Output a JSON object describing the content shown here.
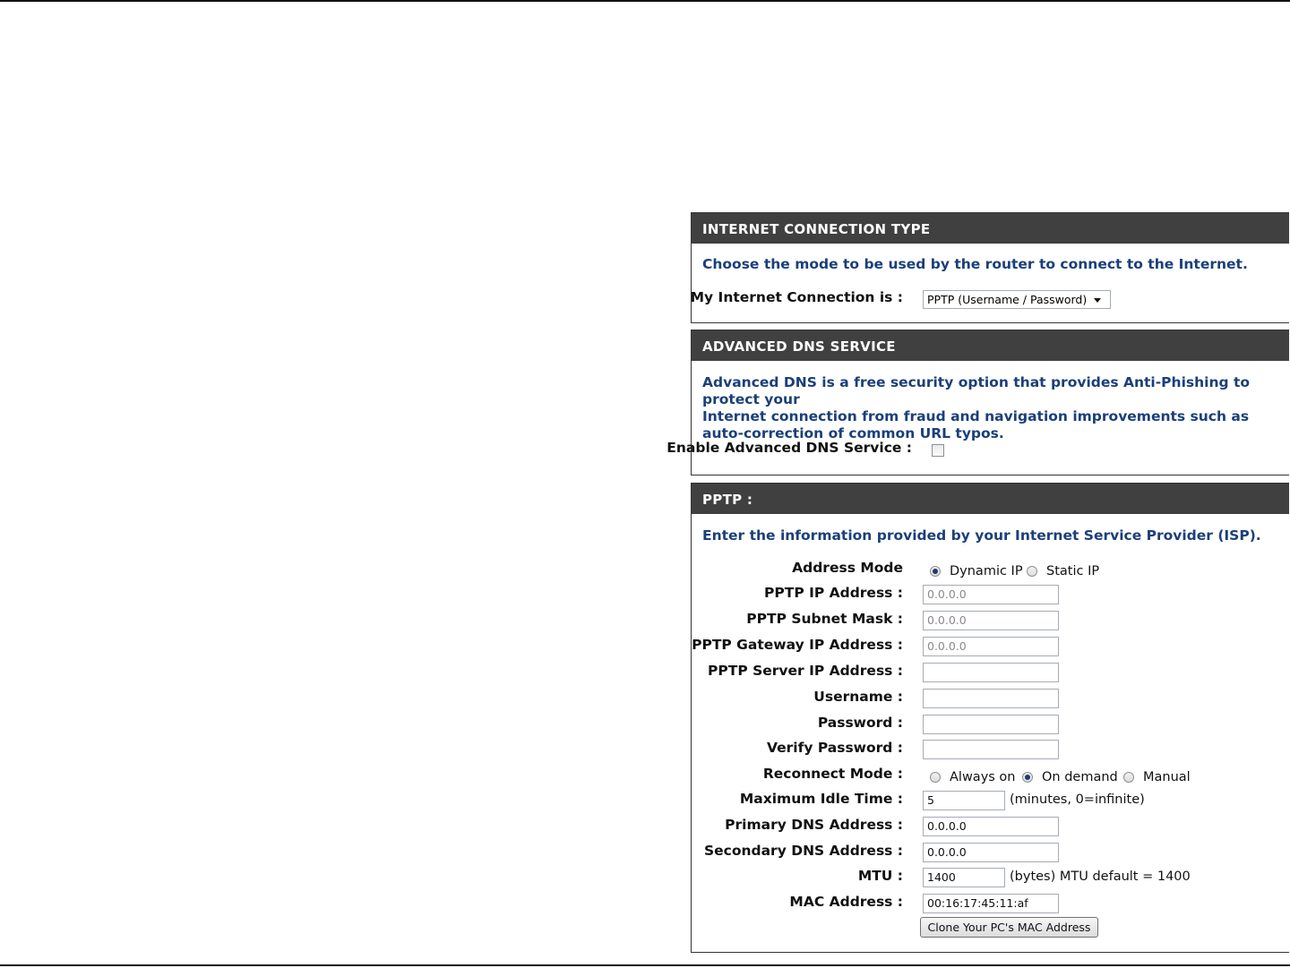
{
  "sections": {
    "connection_type": {
      "header": "INTERNET CONNECTION TYPE",
      "intro": "Choose the mode to be used by the router to connect to the Internet.",
      "label": "My Internet Connection is :",
      "selected": "PPTP (Username / Password)"
    },
    "advanced_dns": {
      "header": "ADVANCED DNS SERVICE",
      "intro_lines": [
        "Advanced DNS is a free security option that provides Anti-Phishing to protect your",
        "Internet connection from fraud and navigation improvements such as",
        "auto-correction of common URL typos."
      ],
      "label": "Enable Advanced DNS Service :",
      "enabled": false
    },
    "pptp": {
      "header": "PPTP :",
      "intro": "Enter the information provided by your Internet Service Provider (ISP).",
      "address_mode": {
        "label": "Address Mode",
        "options": [
          "Dynamic IP",
          "Static IP"
        ],
        "selected": "Dynamic IP"
      },
      "ip_address": {
        "label": "PPTP IP Address :",
        "value": "0.0.0.0"
      },
      "subnet_mask": {
        "label": "PPTP Subnet Mask :",
        "value": "0.0.0.0"
      },
      "gateway": {
        "label": "PPTP Gateway IP Address :",
        "value": "0.0.0.0"
      },
      "server_ip": {
        "label": "PPTP Server IP Address :",
        "value": ""
      },
      "username": {
        "label": "Username :",
        "value": ""
      },
      "password": {
        "label": "Password :",
        "value": ""
      },
      "verify_password": {
        "label": "Verify Password :",
        "value": ""
      },
      "reconnect_mode": {
        "label": "Reconnect Mode :",
        "options": [
          "Always on",
          "On demand",
          "Manual"
        ],
        "selected": "On demand"
      },
      "max_idle": {
        "label": "Maximum Idle Time :",
        "value": "5",
        "note": "(minutes, 0=infinite)"
      },
      "primary_dns": {
        "label": "Primary DNS Address :",
        "value": "0.0.0.0"
      },
      "secondary_dns": {
        "label": "Secondary DNS Address :",
        "value": "0.0.0.0"
      },
      "mtu": {
        "label": "MTU :",
        "value": "1400",
        "note": "(bytes) MTU default = 1400"
      },
      "mac": {
        "label": "MAC Address :",
        "value": "00:16:17:45:11:af"
      },
      "clone_button": "Clone Your PC's MAC Address"
    }
  }
}
